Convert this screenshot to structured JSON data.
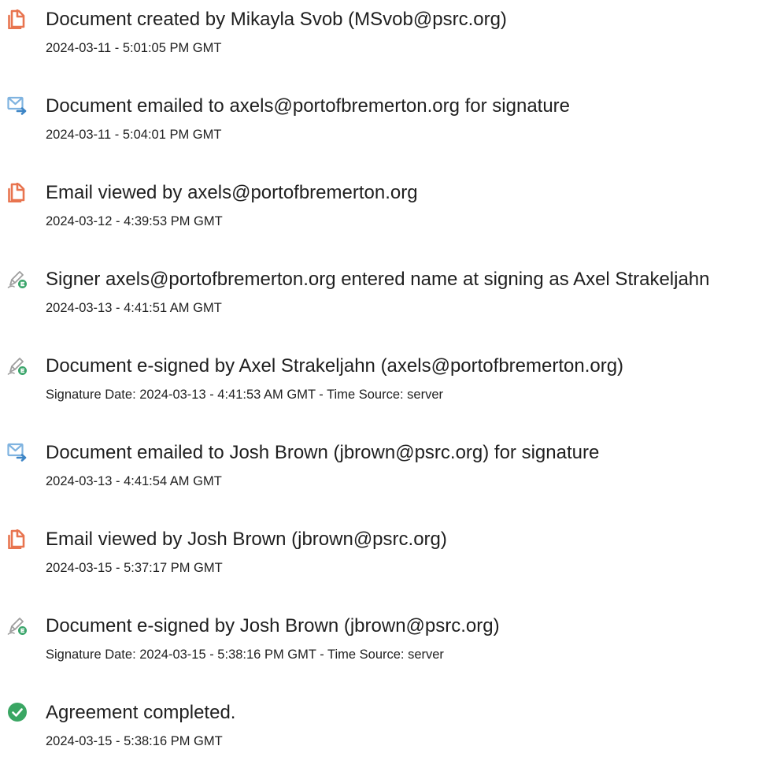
{
  "events": [
    {
      "icon": "document-created-icon",
      "title": "Document created by Mikayla Svob (MSvob@psrc.org)",
      "detail": "2024-03-11 - 5:01:05 PM GMT"
    },
    {
      "icon": "document-emailed-icon",
      "title": "Document emailed to axels@portofbremerton.org for signature",
      "detail": "2024-03-11 - 5:04:01 PM GMT"
    },
    {
      "icon": "email-viewed-icon",
      "title": "Email viewed by axels@portofbremerton.org",
      "detail": "2024-03-12 - 4:39:53 PM GMT"
    },
    {
      "icon": "e-sign-pen-icon",
      "title": "Signer axels@portofbremerton.org entered name at signing as Axel Strakeljahn",
      "detail": "2024-03-13 - 4:41:51 AM GMT"
    },
    {
      "icon": "e-sign-pen-icon",
      "title": "Document e-signed by Axel Strakeljahn (axels@portofbremerton.org)",
      "detail": "Signature Date: 2024-03-13 - 4:41:53 AM GMT - Time Source: server"
    },
    {
      "icon": "document-emailed-icon",
      "title": "Document emailed to Josh Brown (jbrown@psrc.org) for signature",
      "detail": "2024-03-13 - 4:41:54 AM GMT"
    },
    {
      "icon": "email-viewed-icon",
      "title": "Email viewed by Josh Brown (jbrown@psrc.org)",
      "detail": "2024-03-15 - 5:37:17 PM GMT"
    },
    {
      "icon": "e-sign-pen-icon",
      "title": "Document e-signed by Josh Brown (jbrown@psrc.org)",
      "detail": "Signature Date: 2024-03-15 - 5:38:16 PM GMT - Time Source: server"
    },
    {
      "icon": "checkmark-circle-icon",
      "title": "Agreement completed.",
      "detail": "2024-03-15 - 5:38:16 PM GMT"
    }
  ],
  "colors": {
    "document_icon": "#e8744f",
    "email_icon": "#5b9bd5",
    "sign_icon": "#3ba56b",
    "complete_icon": "#3aa663",
    "text": "#1f1f1f"
  }
}
